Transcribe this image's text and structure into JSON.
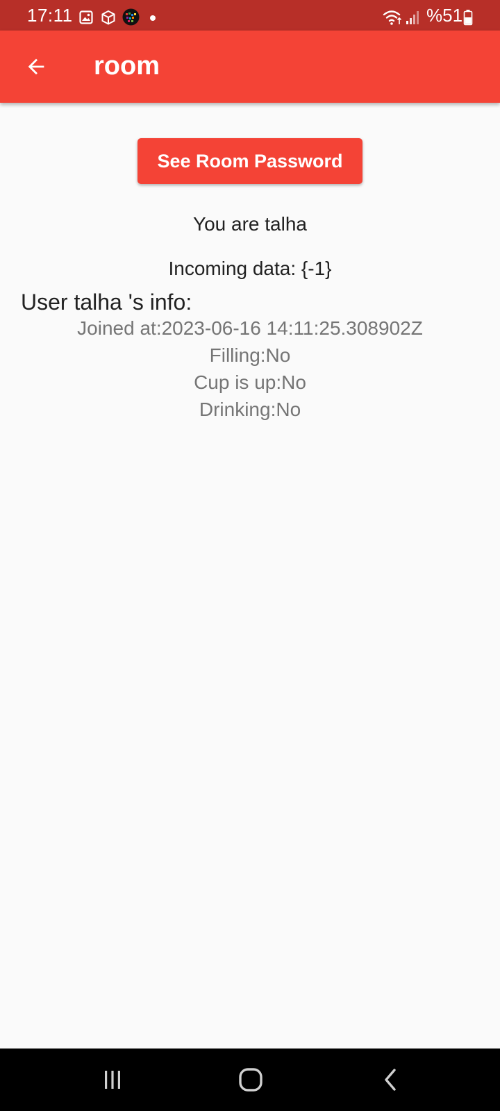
{
  "status_bar": {
    "time": "17:11",
    "battery": "%51",
    "icons": [
      "image-icon",
      "box-icon",
      "app-icon",
      "wifi-icon",
      "signal-icon",
      "battery-icon"
    ]
  },
  "app_bar": {
    "title": "room",
    "back_icon": "arrow-left-icon",
    "color": "#f44336"
  },
  "main": {
    "see_password_label": "See Room Password",
    "you_are": "You are talha",
    "incoming": "Incoming data: {-1}",
    "user_heading": "User talha 's info:",
    "joined": "Joined at:2023-06-16 14:11:25.308902Z",
    "filling": "Filling:No",
    "cup_up": "Cup is up:No",
    "drinking": "Drinking:No"
  },
  "nav_bar": {
    "buttons": [
      "recent-apps-icon",
      "home-icon",
      "back-icon"
    ]
  },
  "colors": {
    "status_bar": "#b72f28",
    "accent": "#f44336",
    "background": "#fafafa",
    "secondary_text": "#757575"
  }
}
